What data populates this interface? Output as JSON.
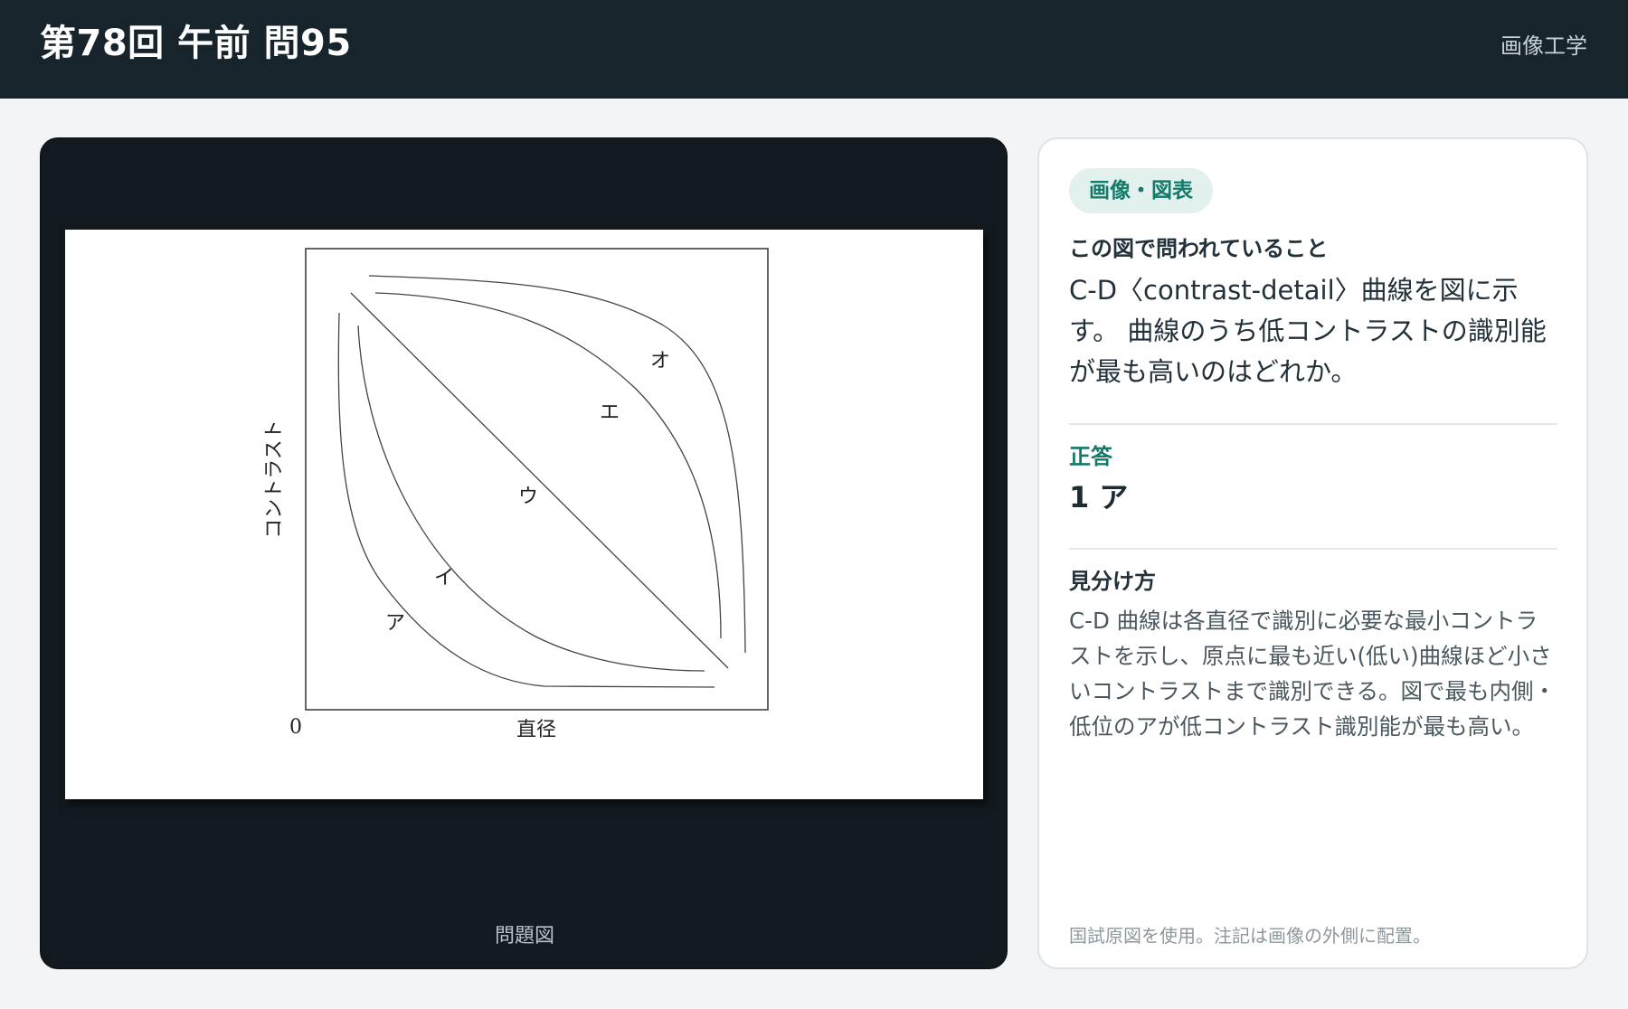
{
  "header": {
    "title": "第78回 午前 問95",
    "subject": "画像工学"
  },
  "figure": {
    "caption": "問題図",
    "axis_x_label": "直径",
    "axis_y_label": "コントラスト",
    "origin_label": "0",
    "curve_labels": {
      "a": "ア",
      "i": "イ",
      "u": "ウ",
      "e": "エ",
      "o": "オ"
    }
  },
  "info": {
    "tag": "画像・図表",
    "question_heading": "この図で問われていること",
    "question_text": "C-D〈contrast-detail〉曲線を図に示す。 曲線のうち低コントラストの識別能が最も高いのはどれか。",
    "answer_label": "正答",
    "answer_value": "1 ア",
    "hint_label": "見分け方",
    "hint_text": "C-D 曲線は各直径で識別に必要な最小コントラストを示し、原点に最も近い(低い)曲線ほど小さいコントラストまで識別できる。図で最も内側・低位のアが低コントラスト識別能が最も高い。",
    "footnote": "国試原図を使用。注記は画像の外側に配置。"
  },
  "colors": {
    "header_bg": "#18242c",
    "figure_panel_bg": "#121a20",
    "accent": "#147a6a",
    "tag_bg": "#e2f1ee"
  }
}
